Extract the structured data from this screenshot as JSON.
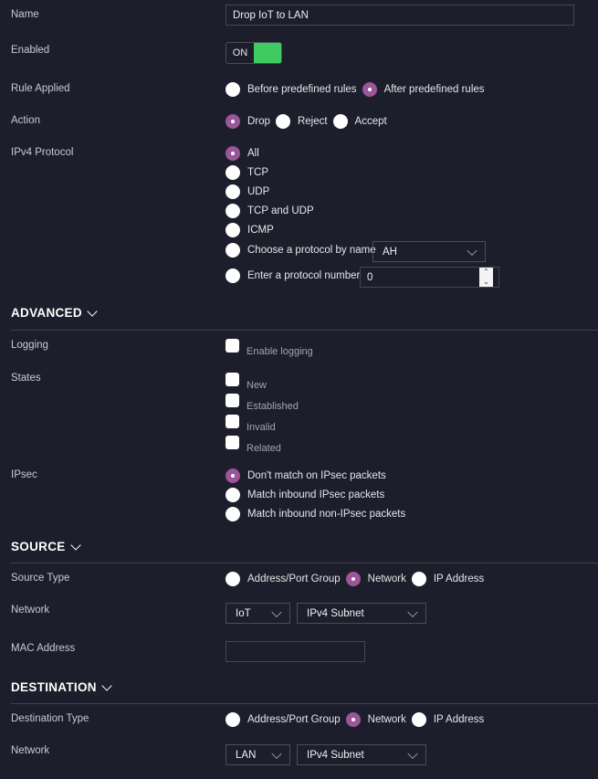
{
  "name": {
    "label": "Name",
    "value": "Drop IoT to LAN"
  },
  "enabled": {
    "label": "Enabled",
    "state": "ON",
    "on": true,
    "color": "#3ecb61"
  },
  "rule_applied": {
    "label": "Rule Applied",
    "options": [
      "Before predefined rules",
      "After predefined rules"
    ],
    "selected": 1
  },
  "action": {
    "label": "Action",
    "options": [
      "Drop",
      "Reject",
      "Accept"
    ],
    "selected": 0
  },
  "ipv4_protocol": {
    "label": "IPv4 Protocol",
    "options": [
      "All",
      "TCP",
      "UDP",
      "TCP and UDP",
      "ICMP",
      "Choose a protocol by name",
      "Enter a protocol number"
    ],
    "selected": 0,
    "protocol_name_value": "AH",
    "protocol_number_value": "0"
  },
  "advanced": {
    "title": "ADVANCED",
    "logging": {
      "label": "Logging",
      "option": "Enable logging",
      "checked": false
    },
    "states": {
      "label": "States",
      "options": [
        "New",
        "Established",
        "Invalid",
        "Related"
      ]
    },
    "ipsec": {
      "label": "IPsec",
      "options": [
        "Don't match on IPsec packets",
        "Match inbound IPsec packets",
        "Match inbound non-IPsec packets"
      ],
      "selected": 0
    }
  },
  "source": {
    "title": "SOURCE",
    "type": {
      "label": "Source Type",
      "options": [
        "Address/Port Group",
        "Network",
        "IP Address"
      ],
      "selected": 1
    },
    "network": {
      "label": "Network",
      "value": "IoT",
      "subnet": "IPv4 Subnet"
    },
    "mac": {
      "label": "MAC Address",
      "value": ""
    }
  },
  "destination": {
    "title": "DESTINATION",
    "type": {
      "label": "Destination Type",
      "options": [
        "Address/Port Group",
        "Network",
        "IP Address"
      ],
      "selected": 1
    },
    "network": {
      "label": "Network",
      "value": "LAN",
      "subnet": "IPv4 Subnet"
    }
  },
  "colors": {
    "background": "#1c1e2b",
    "accent": "#9c5598",
    "toggle_on": "#3ecb61"
  }
}
